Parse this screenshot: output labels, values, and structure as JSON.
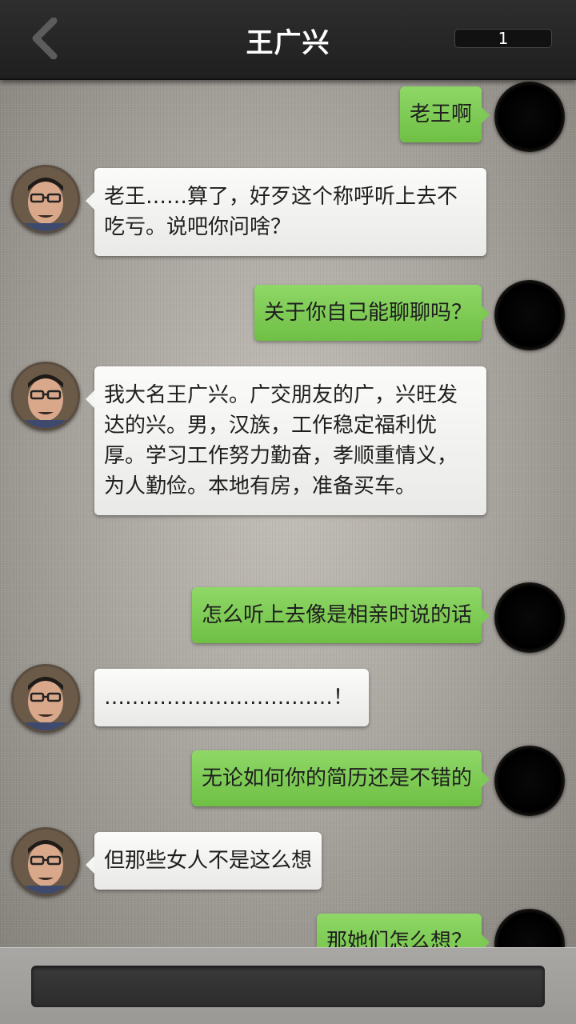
{
  "header": {
    "title": "王广兴",
    "counter": "1"
  },
  "messages": [
    {
      "side": "right",
      "text": "老王啊"
    },
    {
      "side": "left",
      "text": "老王……算了，好歹这个称呼听上去不吃亏。说吧你问啥？"
    },
    {
      "side": "right",
      "text": "关于你自己能聊聊吗？"
    },
    {
      "side": "left",
      "text": "我大名王广兴。广交朋友的广，兴旺发达的兴。男，汉族，工作稳定福利优厚。学习工作努力勤奋，孝顺重情义，为人勤俭。本地有房，准备买车。"
    },
    {
      "side": "right",
      "text": "怎么听上去像是相亲时说的话"
    },
    {
      "side": "left",
      "text": "……………………………！"
    },
    {
      "side": "right",
      "text": "无论如何你的简历还是不错的"
    },
    {
      "side": "left",
      "text": "但那些女人不是这么想"
    },
    {
      "side": "right",
      "text": "那她们怎么想？"
    }
  ],
  "input": {
    "value": ""
  },
  "colors": {
    "green_bubble": "#7ec955",
    "header": "#262626"
  },
  "icons": {
    "back": "chevron-left-icon"
  }
}
